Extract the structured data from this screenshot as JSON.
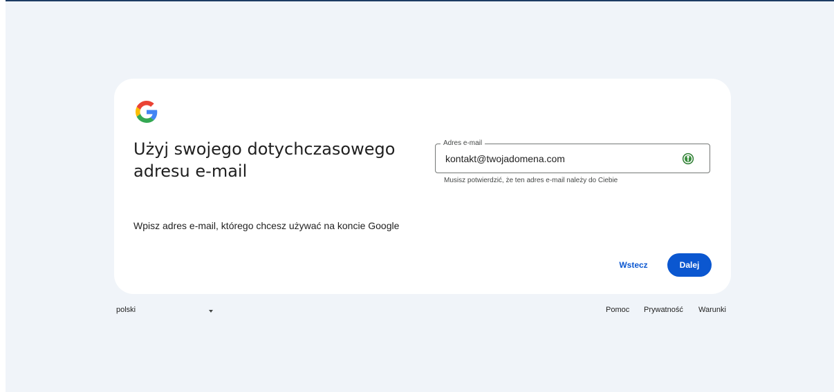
{
  "card": {
    "logo": "google-g-logo",
    "title": "Użyj swojego dotychczasowego adresu e-mail",
    "subtitle": "Wpisz adres e-mail, którego chcesz używać na koncie Google",
    "email_field": {
      "label": "Adres e-mail",
      "value": "kontakt@twojadomena.com",
      "icon": "password-manager-icon"
    },
    "helper_text": "Musisz potwierdzić, że ten adres e-mail należy do Ciebie",
    "back_label": "Wstecz",
    "next_label": "Dalej"
  },
  "footer": {
    "language": "polski",
    "links": {
      "help": "Pomoc",
      "privacy": "Prywatność",
      "terms": "Warunki"
    }
  },
  "colors": {
    "accent": "#0b57d0",
    "page_background": "#f0f4f9",
    "card_background": "#ffffff"
  }
}
